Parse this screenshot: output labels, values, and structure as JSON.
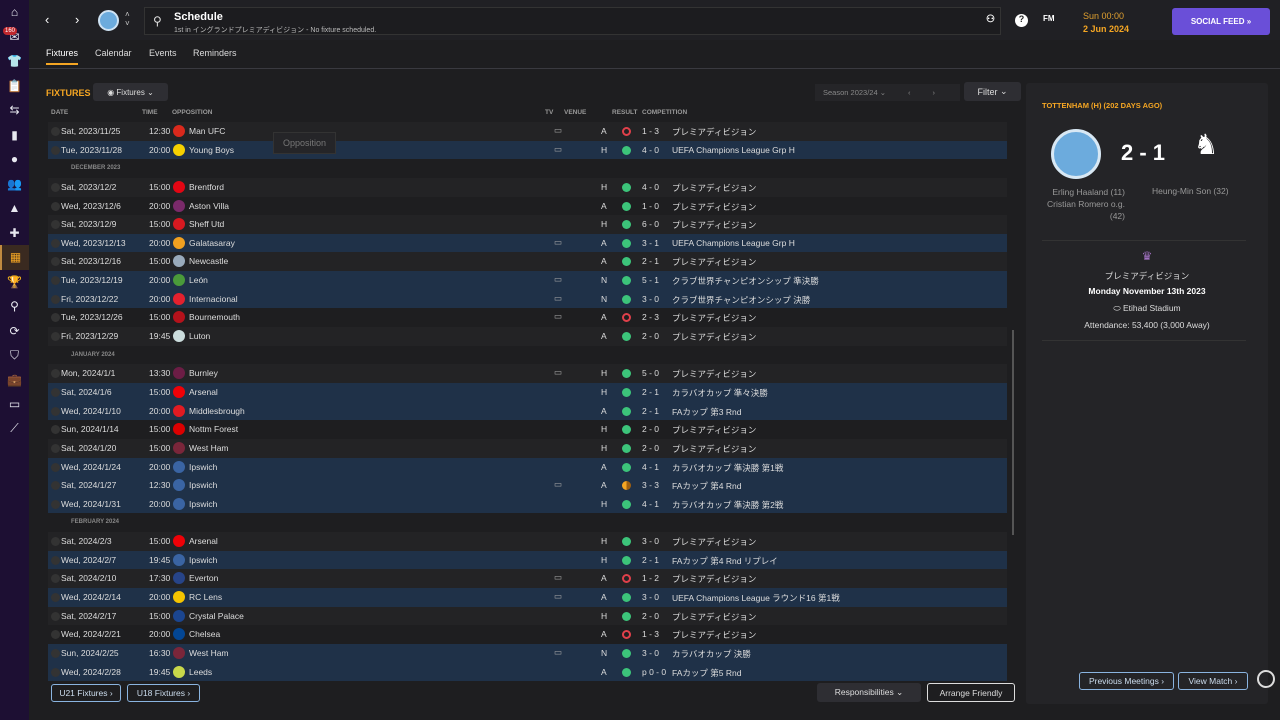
{
  "sidebar": {
    "items": [
      {
        "icon": "home-icon",
        "g": "⌂"
      },
      {
        "icon": "inbox-icon",
        "g": "✉",
        "badge": "160"
      },
      {
        "icon": "squad-icon",
        "g": "👕"
      },
      {
        "icon": "tactics-icon",
        "g": "📋"
      },
      {
        "icon": "staff-icon",
        "g": "⇆"
      },
      {
        "icon": "report-icon",
        "g": "▮"
      },
      {
        "icon": "ball-icon",
        "g": "●"
      },
      {
        "icon": "people-icon",
        "g": "👥"
      },
      {
        "icon": "training-icon",
        "g": "▲"
      },
      {
        "icon": "medical-icon",
        "g": "✚"
      },
      {
        "icon": "calendar-icon",
        "g": "▦",
        "active": true
      },
      {
        "icon": "trophy-icon",
        "g": "🏆"
      },
      {
        "icon": "scouting-icon",
        "g": "⚲"
      },
      {
        "icon": "transfers-icon",
        "g": "⟳"
      },
      {
        "icon": "club-icon",
        "g": "⛉"
      },
      {
        "icon": "finances-icon",
        "g": "💼"
      },
      {
        "icon": "money-icon",
        "g": "▭"
      },
      {
        "icon": "dev-icon",
        "g": "⟋"
      }
    ]
  },
  "header": {
    "title": "Schedule",
    "subtitle": "1st in イングランドプレミアディビジョン - No fixture scheduled.",
    "fm": "FM",
    "time": "Sun 00:00",
    "date": "2 Jun 2024",
    "social": "SOCIAL FEED »"
  },
  "tabs": [
    "Fixtures",
    "Calendar",
    "Events",
    "Reminders"
  ],
  "fixtures": {
    "heading": "FIXTURES",
    "view": "Fixtures",
    "season": "Season 2023/24",
    "filter": "Filter",
    "tooltip": "Opposition",
    "columns": {
      "date": "DATE",
      "time": "TIME",
      "opposition": "OPPOSITION",
      "tv": "TV",
      "venue": "VENUE",
      "result": "RESULT",
      "competition": "COMPETITION"
    },
    "rows": [
      {
        "date": "Sat, 2023/11/25",
        "time": "12:30",
        "opp": "Man UFC",
        "tv": true,
        "venue": "A",
        "outcome": "L",
        "score": "1 - 3",
        "comp": "プレミアディビジョン",
        "color": "#da291c"
      },
      {
        "date": "Tue, 2023/11/28",
        "time": "20:00",
        "opp": "Young Boys",
        "tv": true,
        "venue": "H",
        "outcome": "W",
        "score": "4 - 0",
        "comp": "UEFA Champions League Grp H",
        "cup": true,
        "color": "#f5d000"
      },
      {
        "section": "DECEMBER 2023"
      },
      {
        "date": "Sat, 2023/12/2",
        "time": "15:00",
        "opp": "Brentford",
        "venue": "H",
        "outcome": "W",
        "score": "4 - 0",
        "comp": "プレミアディビジョン",
        "color": "#e30613"
      },
      {
        "date": "Wed, 2023/12/6",
        "time": "20:00",
        "opp": "Aston Villa",
        "venue": "A",
        "outcome": "W",
        "score": "1 - 0",
        "comp": "プレミアディビジョン",
        "color": "#7a2a6a"
      },
      {
        "date": "Sat, 2023/12/9",
        "time": "15:00",
        "opp": "Sheff Utd",
        "venue": "H",
        "outcome": "W",
        "score": "6 - 0",
        "comp": "プレミアディビジョン",
        "color": "#d71920"
      },
      {
        "date": "Wed, 2023/12/13",
        "time": "20:00",
        "opp": "Galatasaray",
        "tv": true,
        "venue": "A",
        "outcome": "W",
        "score": "3 - 1",
        "comp": "UEFA Champions League Grp H",
        "cup": true,
        "color": "#f0a020"
      },
      {
        "date": "Sat, 2023/12/16",
        "time": "15:00",
        "opp": "Newcastle",
        "venue": "A",
        "outcome": "W",
        "score": "2 - 1",
        "comp": "プレミアディビジョン",
        "color": "#9ab"
      },
      {
        "date": "Tue, 2023/12/19",
        "time": "20:00",
        "opp": "León",
        "tv": true,
        "venue": "N",
        "outcome": "W",
        "score": "5 - 1",
        "comp": "クラブ世界チャンピオンシップ 準決勝",
        "cup": true,
        "color": "#4a9a3a"
      },
      {
        "date": "Fri, 2023/12/22",
        "time": "20:00",
        "opp": "Internacional",
        "tv": true,
        "venue": "N",
        "outcome": "W",
        "score": "3 - 0",
        "comp": "クラブ世界チャンピオンシップ 決勝",
        "cup": true,
        "color": "#e4212e"
      },
      {
        "date": "Tue, 2023/12/26",
        "time": "15:00",
        "opp": "Bournemouth",
        "tv": true,
        "venue": "A",
        "outcome": "L",
        "score": "2 - 3",
        "comp": "プレミアディビジョン",
        "color": "#b5121b"
      },
      {
        "date": "Fri, 2023/12/29",
        "time": "19:45",
        "opp": "Luton",
        "venue": "A",
        "outcome": "W",
        "score": "2 - 0",
        "comp": "プレミアディビジョン",
        "color": "#cdd"
      },
      {
        "section": "JANUARY 2024"
      },
      {
        "date": "Mon, 2024/1/1",
        "time": "13:30",
        "opp": "Burnley",
        "tv": true,
        "venue": "H",
        "outcome": "W",
        "score": "5 - 0",
        "comp": "プレミアディビジョン",
        "color": "#6c1d45"
      },
      {
        "date": "Sat, 2024/1/6",
        "time": "15:00",
        "opp": "Arsenal",
        "venue": "H",
        "outcome": "W",
        "score": "2 - 1",
        "comp": "カラバオカップ 準々決勝",
        "cup": true,
        "color": "#ef0107"
      },
      {
        "date": "Wed, 2024/1/10",
        "time": "20:00",
        "opp": "Middlesbrough",
        "venue": "A",
        "outcome": "W",
        "score": "2 - 1",
        "comp": "FAカップ 第3 Rnd",
        "cup": true,
        "color": "#e11b22"
      },
      {
        "date": "Sun, 2024/1/14",
        "time": "15:00",
        "opp": "Nottm Forest",
        "venue": "H",
        "outcome": "W",
        "score": "2 - 0",
        "comp": "プレミアディビジョン",
        "color": "#dd0000"
      },
      {
        "date": "Sat, 2024/1/20",
        "time": "15:00",
        "opp": "West Ham",
        "venue": "H",
        "outcome": "W",
        "score": "2 - 0",
        "comp": "プレミアディビジョン",
        "color": "#7a263a"
      },
      {
        "date": "Wed, 2024/1/24",
        "time": "20:00",
        "opp": "Ipswich",
        "venue": "A",
        "outcome": "W",
        "score": "4 - 1",
        "comp": "カラバオカップ 準決勝 第1戦",
        "cup": true,
        "color": "#3a64a3"
      },
      {
        "date": "Sat, 2024/1/27",
        "time": "12:30",
        "opp": "Ipswich",
        "tv": true,
        "venue": "A",
        "outcome": "D",
        "score": "3 - 3",
        "comp": "FAカップ 第4 Rnd",
        "cup": true,
        "color": "#3a64a3"
      },
      {
        "date": "Wed, 2024/1/31",
        "time": "20:00",
        "opp": "Ipswich",
        "venue": "H",
        "outcome": "W",
        "score": "4 - 1",
        "comp": "カラバオカップ 準決勝 第2戦",
        "cup": true,
        "color": "#3a64a3"
      },
      {
        "section": "FEBRUARY 2024"
      },
      {
        "date": "Sat, 2024/2/3",
        "time": "15:00",
        "opp": "Arsenal",
        "venue": "H",
        "outcome": "W",
        "score": "3 - 0",
        "comp": "プレミアディビジョン",
        "color": "#ef0107"
      },
      {
        "date": "Wed, 2024/2/7",
        "time": "19:45",
        "opp": "Ipswich",
        "venue": "H",
        "outcome": "W",
        "score": "2 - 1",
        "comp": "FAカップ 第4 Rnd リプレイ",
        "cup": true,
        "color": "#3a64a3"
      },
      {
        "date": "Sat, 2024/2/10",
        "time": "17:30",
        "opp": "Everton",
        "tv": true,
        "venue": "A",
        "outcome": "L",
        "score": "1 - 2",
        "comp": "プレミアディビジョン",
        "color": "#274488"
      },
      {
        "date": "Wed, 2024/2/14",
        "time": "20:00",
        "opp": "RC Lens",
        "tv": true,
        "venue": "A",
        "outcome": "W",
        "score": "3 - 0",
        "comp": "UEFA Champions League ラウンド16 第1戦",
        "cup": true,
        "color": "#f5c400"
      },
      {
        "date": "Sat, 2024/2/17",
        "time": "15:00",
        "opp": "Crystal Palace",
        "venue": "H",
        "outcome": "W",
        "score": "2 - 0",
        "comp": "プレミアディビジョン",
        "color": "#1b458f"
      },
      {
        "date": "Wed, 2024/2/21",
        "time": "20:00",
        "opp": "Chelsea",
        "venue": "A",
        "outcome": "L",
        "score": "1 - 3",
        "comp": "プレミアディビジョン",
        "color": "#034694"
      },
      {
        "date": "Sun, 2024/2/25",
        "time": "16:30",
        "opp": "West Ham",
        "tv": true,
        "venue": "N",
        "outcome": "W",
        "score": "3 - 0",
        "comp": "カラバオカップ 決勝",
        "cup": true,
        "color": "#7a263a"
      },
      {
        "date": "Wed, 2024/2/28",
        "time": "19:45",
        "opp": "Leeds",
        "venue": "A",
        "outcome": "W",
        "score": "p 0 - 0",
        "comp": "FAカップ 第5 Rnd",
        "cup": true,
        "color": "#c8d84a"
      }
    ]
  },
  "footer": {
    "u21": "U21 Fixtures ›",
    "u18": "U18 Fixtures ›",
    "responsibilities": "Responsibilities ⌄",
    "arrange": "Arrange Friendly"
  },
  "panel": {
    "title": "TOTTENHAM (H) (202 DAYS AGO)",
    "score": "2 - 1",
    "home_scorers": [
      "Erling Haaland (11)",
      "Cristian Romero o.g.",
      "(42)"
    ],
    "away_scorers": [
      "Heung-Min Son (32)"
    ],
    "competition": "プレミアディビジョン",
    "date": "Monday November 13th 2023",
    "stadium": "Etihad Stadium",
    "attendance": "Attendance: 53,400 (3,000 Away)",
    "prev": "Previous Meetings ›",
    "view": "View Match ›"
  },
  "colors": {
    "accent": "#f5a623",
    "win": "#3cc47a",
    "loss": "#e0404a",
    "draw": "#f5a623",
    "social": "#6a4fd8",
    "cup_row": "#1f3148"
  }
}
